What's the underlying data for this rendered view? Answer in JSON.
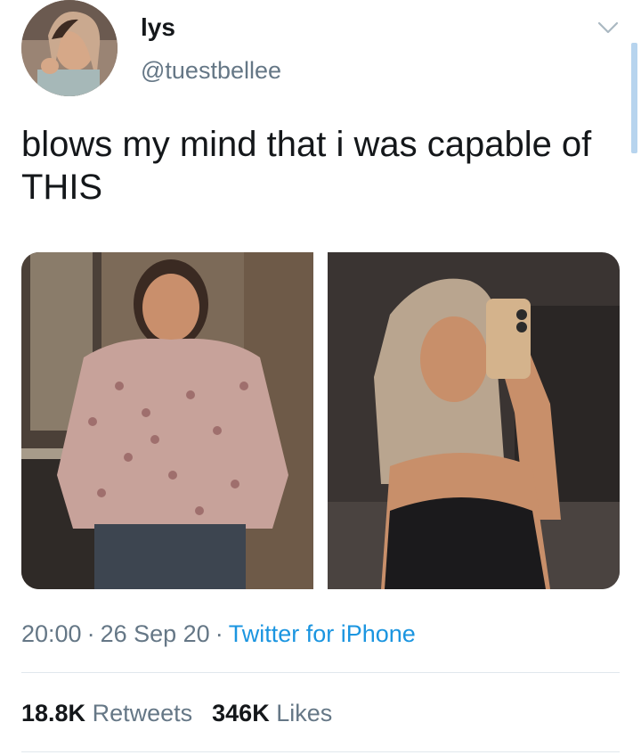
{
  "user": {
    "display_name": "lys",
    "handle": "@tuestbellee"
  },
  "tweet": {
    "text": "blows my mind that i was capable of THIS"
  },
  "meta": {
    "time": "20:00",
    "separator": "·",
    "date": "26 Sep 20",
    "source": "Twitter for iPhone"
  },
  "stats": {
    "retweets_count": "18.8K",
    "retweets_label": "Retweets",
    "likes_count": "346K",
    "likes_label": "Likes"
  },
  "colors": {
    "text": "#14171a",
    "secondary": "#657786",
    "link": "#1b95e0",
    "divider": "#e1e8ed"
  },
  "icons": {
    "more": "chevron-down-icon"
  }
}
